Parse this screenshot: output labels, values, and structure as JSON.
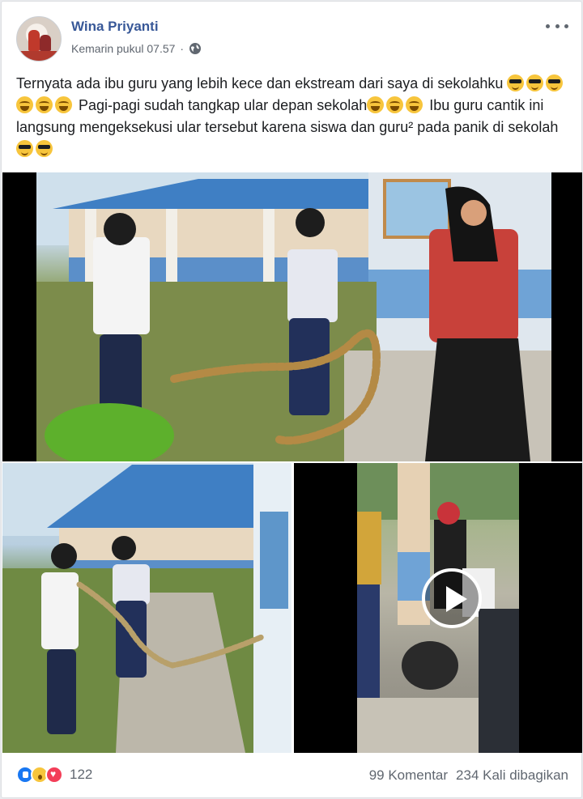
{
  "post": {
    "author": "Wina Priyanti",
    "timestamp": "Kemarin pukul 07.57",
    "privacy_icon": "globe-icon",
    "text_segments": [
      {
        "type": "text",
        "value": "Ternyata ada ibu guru yang lebih kece dan ekstream dari saya di sekolahku "
      },
      {
        "type": "emoji",
        "value": "cool"
      },
      {
        "type": "emoji",
        "value": "cool"
      },
      {
        "type": "emoji",
        "value": "cool"
      },
      {
        "type": "emoji",
        "value": "joy"
      },
      {
        "type": "emoji",
        "value": "joy"
      },
      {
        "type": "emoji",
        "value": "joy"
      },
      {
        "type": "text",
        "value": " Pagi-pagi sudah tangkap ular depan sekolah"
      },
      {
        "type": "emoji",
        "value": "joy"
      },
      {
        "type": "emoji",
        "value": "joy"
      },
      {
        "type": "emoji",
        "value": "joy"
      },
      {
        "type": "text",
        "value": " Ibu guru cantik ini langsung mengeksekusi ular tersebut karena siswa dan guru² pada panik di sekolah"
      },
      {
        "type": "emoji",
        "value": "cool"
      },
      {
        "type": "emoji",
        "value": "cool"
      }
    ]
  },
  "footer": {
    "reaction_count": "122",
    "comments": "99 Komentar",
    "shares": "234 Kali dibagikan"
  },
  "colors": {
    "author_link": "#385898",
    "meta_text": "#606770",
    "like_blue": "#1877f2",
    "love_red": "#f33e58",
    "wow_yellow": "#f7c53c"
  }
}
